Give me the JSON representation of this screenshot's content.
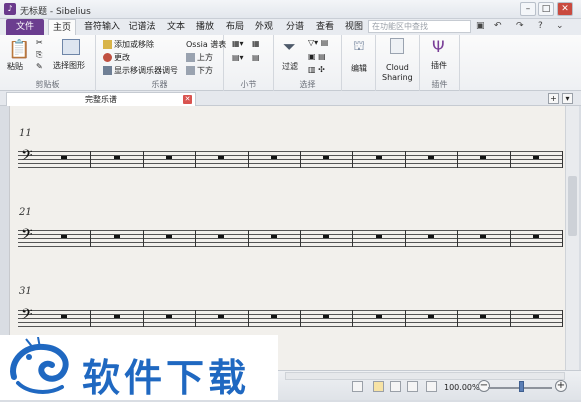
{
  "window": {
    "title": "无标题 - Sibelius"
  },
  "ribbon_tabs": [
    "文件",
    "主页",
    "音符输入",
    "记谱法",
    "文本",
    "播放",
    "布局",
    "外观",
    "分谱",
    "查看",
    "视图"
  ],
  "search_placeholder": "在功能区中查找",
  "clipboard": {
    "paste": "粘贴",
    "select_graph": "选择图形",
    "group": "剪贴板"
  },
  "instruments": {
    "add_remove": "添加或移除",
    "change": "更改",
    "show_transposed": "显示移调乐器调号",
    "ossia_staff": "Ossia 谱表",
    "above": "上方",
    "below": "下方",
    "group": "乐器"
  },
  "bars_group": "小节",
  "select_group": {
    "filter": "过滤",
    "group": "选择"
  },
  "edit": "编辑",
  "cloud": {
    "line1": "Cloud",
    "line2": "Sharing"
  },
  "plugins": {
    "label": "插件",
    "group": "插件"
  },
  "document_tab": "完整乐谱",
  "score": {
    "clef_glyph": "𝄢",
    "systems": [
      11,
      21,
      31
    ]
  },
  "status": {
    "zoom": "100.00%"
  },
  "watermark": {
    "text": "软件下载"
  },
  "colors": {
    "file_tab": "#6b3d8f",
    "watermark": "#1f68c1"
  }
}
